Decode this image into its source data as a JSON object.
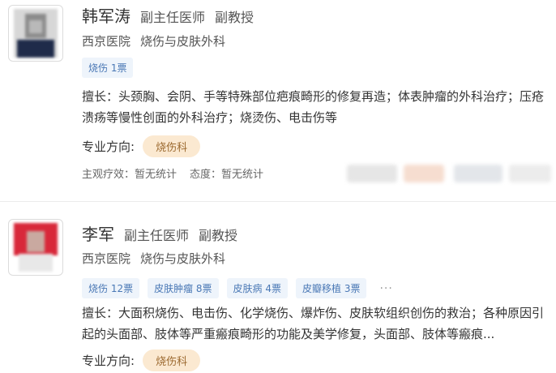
{
  "doctors": [
    {
      "name": "韩军涛",
      "title": "副主任医师",
      "rank": "副教授",
      "hospital": "西京医院",
      "department": "烧伤与皮肤外科",
      "tags": [
        "烧伤 1票"
      ],
      "skill": "擅长：头颈胸、会阴、手等特殊部位疤痕畸形的修复再造；体表肿瘤的外科治疗；压疮溃疡等慢性创面的外科治疗；烧烫伤、电击伤等",
      "direction_label": "专业方向:",
      "direction_value": "烧伤科",
      "efficacy": "主观疗效：暂无统计",
      "attitude": "态度：暂无统计"
    },
    {
      "name": "李军",
      "title": "副主任医师",
      "rank": "副教授",
      "hospital": "西京医院",
      "department": "烧伤与皮肤外科",
      "tags": [
        "烧伤 12票",
        "皮肤肿瘤 8票",
        "皮肤病 4票",
        "皮瓣移植 3票"
      ],
      "more": "···",
      "skill": "擅长：大面积烧伤、电击伤、化学烧伤、爆炸伤、皮肤软组织创伤的救治；各种原因引起的头面部、肢体等严重瘢痕畸形的功能及美学修复，头面部、肢体等瘢痕...",
      "direction_label": "专业方向:",
      "direction_value": "烧伤科"
    }
  ],
  "colors": {
    "tag_bg": "#eef4fb",
    "tag_text": "#4a78b5",
    "direction_bg": "#fbe9d1",
    "direction_text": "#9c6a30"
  }
}
